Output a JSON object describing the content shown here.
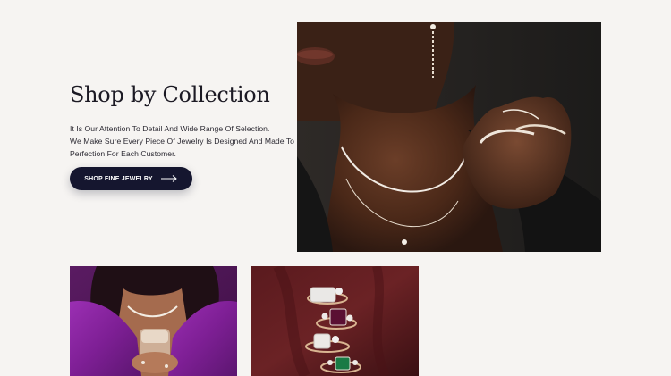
{
  "collection": {
    "title": "Shop by Collection",
    "description_lines": [
      "It Is Our Attention To Detail And Wide Range Of Selection.",
      "We Make Sure Every Piece Of Jewelry Is Designed And Made To",
      "Perfection For Each Customer."
    ],
    "cta_label": "SHOP FINE JEWELRY"
  },
  "images": {
    "hero": "necklace-model-photo",
    "tile_left": "purple-dress-model-photo",
    "tile_right": "rings-on-red-background-photo"
  },
  "colors": {
    "background": "#f6f4f2",
    "button": "#15162f",
    "text": "#1c1a24"
  }
}
